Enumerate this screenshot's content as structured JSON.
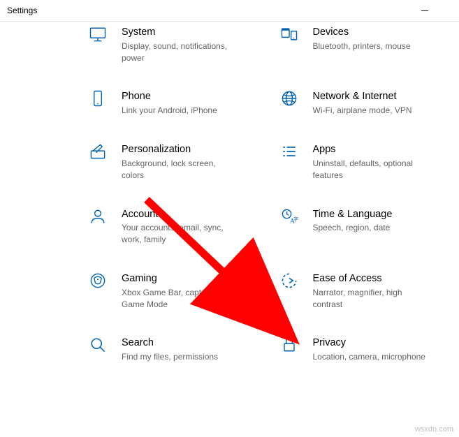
{
  "window": {
    "title": "Settings"
  },
  "tiles": {
    "system": {
      "title": "System",
      "sub": "Display, sound, notifications, power"
    },
    "devices": {
      "title": "Devices",
      "sub": "Bluetooth, printers, mouse"
    },
    "phone": {
      "title": "Phone",
      "sub": "Link your Android, iPhone"
    },
    "network": {
      "title": "Network & Internet",
      "sub": "Wi-Fi, airplane mode, VPN"
    },
    "personal": {
      "title": "Personalization",
      "sub": "Background, lock screen, colors"
    },
    "apps": {
      "title": "Apps",
      "sub": "Uninstall, defaults, optional features"
    },
    "accounts": {
      "title": "Accounts",
      "sub": "Your accounts, email, sync, work, family"
    },
    "timelang": {
      "title": "Time & Language",
      "sub": "Speech, region, date"
    },
    "gaming": {
      "title": "Gaming",
      "sub": "Xbox Game Bar, captures, Game Mode"
    },
    "ease": {
      "title": "Ease of Access",
      "sub": "Narrator, magnifier, high contrast"
    },
    "search": {
      "title": "Search",
      "sub": "Find my files, permissions"
    },
    "privacy": {
      "title": "Privacy",
      "sub": "Location, camera, microphone"
    }
  },
  "watermark": "wsxdn.com",
  "accent": "#0062b1"
}
